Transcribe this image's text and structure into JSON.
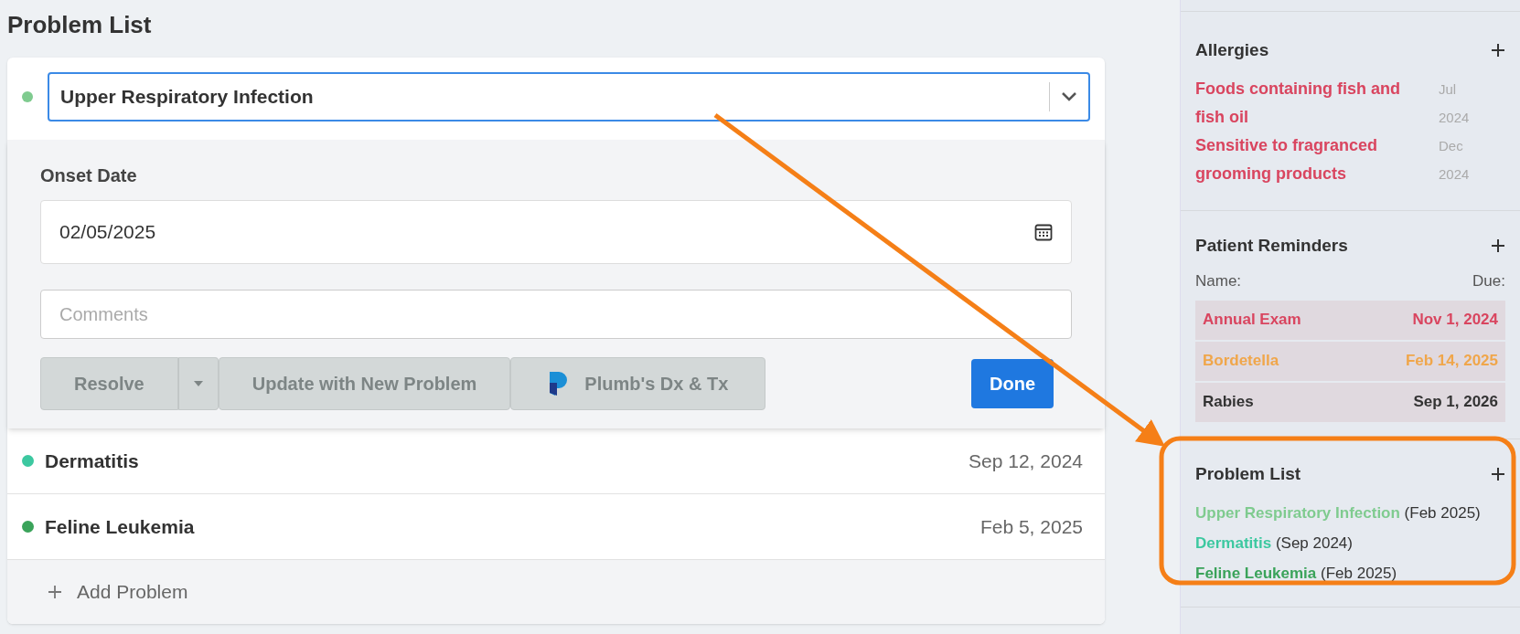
{
  "page_title": "Problem List",
  "editor": {
    "problem": "Upper Respiratory Infection",
    "color": "#7fcb8f",
    "onset_label": "Onset Date",
    "onset_value": "02/05/2025",
    "comments_placeholder": "Comments",
    "buttons": [
      {
        "kind": "split",
        "label": "Resolve"
      },
      {
        "kind": "plain",
        "label": "Update with New Problem"
      },
      {
        "kind": "logo",
        "label": "Plumb's Dx & Tx"
      }
    ],
    "done": "Done"
  },
  "problems": [
    {
      "name": "Dermatitis",
      "date": "Sep 12, 2024",
      "color": "#3cc8a0"
    },
    {
      "name": "Feline Leukemia",
      "date": "Feb 5, 2025",
      "color": "#3aa35a"
    }
  ],
  "add_problem": "Add Problem",
  "sidebar": {
    "allergies": {
      "title": "Allergies",
      "items": [
        {
          "name": "Foods containing fish and fish oil",
          "date": "Jul 2024"
        },
        {
          "name": "Sensitive to fragranced grooming products",
          "date": "Dec 2024"
        }
      ]
    },
    "reminders": {
      "title": "Patient Reminders",
      "name_label": "Name:",
      "due_label": "Due:",
      "items": [
        {
          "name": "Annual Exam",
          "due": "Nov 1, 2024",
          "color": "#d9455f"
        },
        {
          "name": "Bordetella",
          "due": "Feb 14, 2025",
          "color": "#f0a64a"
        },
        {
          "name": "Rabies",
          "due": "Sep 1, 2026",
          "color": "#333333"
        }
      ]
    },
    "problems": {
      "title": "Problem List",
      "items": [
        {
          "name": "Upper Respiratory Infection",
          "date": "(Feb 2025)",
          "color": "#7fcb8f"
        },
        {
          "name": "Dermatitis",
          "date": "(Sep 2024)",
          "color": "#3cc8a0"
        },
        {
          "name": "Feline Leukemia",
          "date": "(Feb 2025)",
          "color": "#3aa35a"
        }
      ]
    }
  }
}
